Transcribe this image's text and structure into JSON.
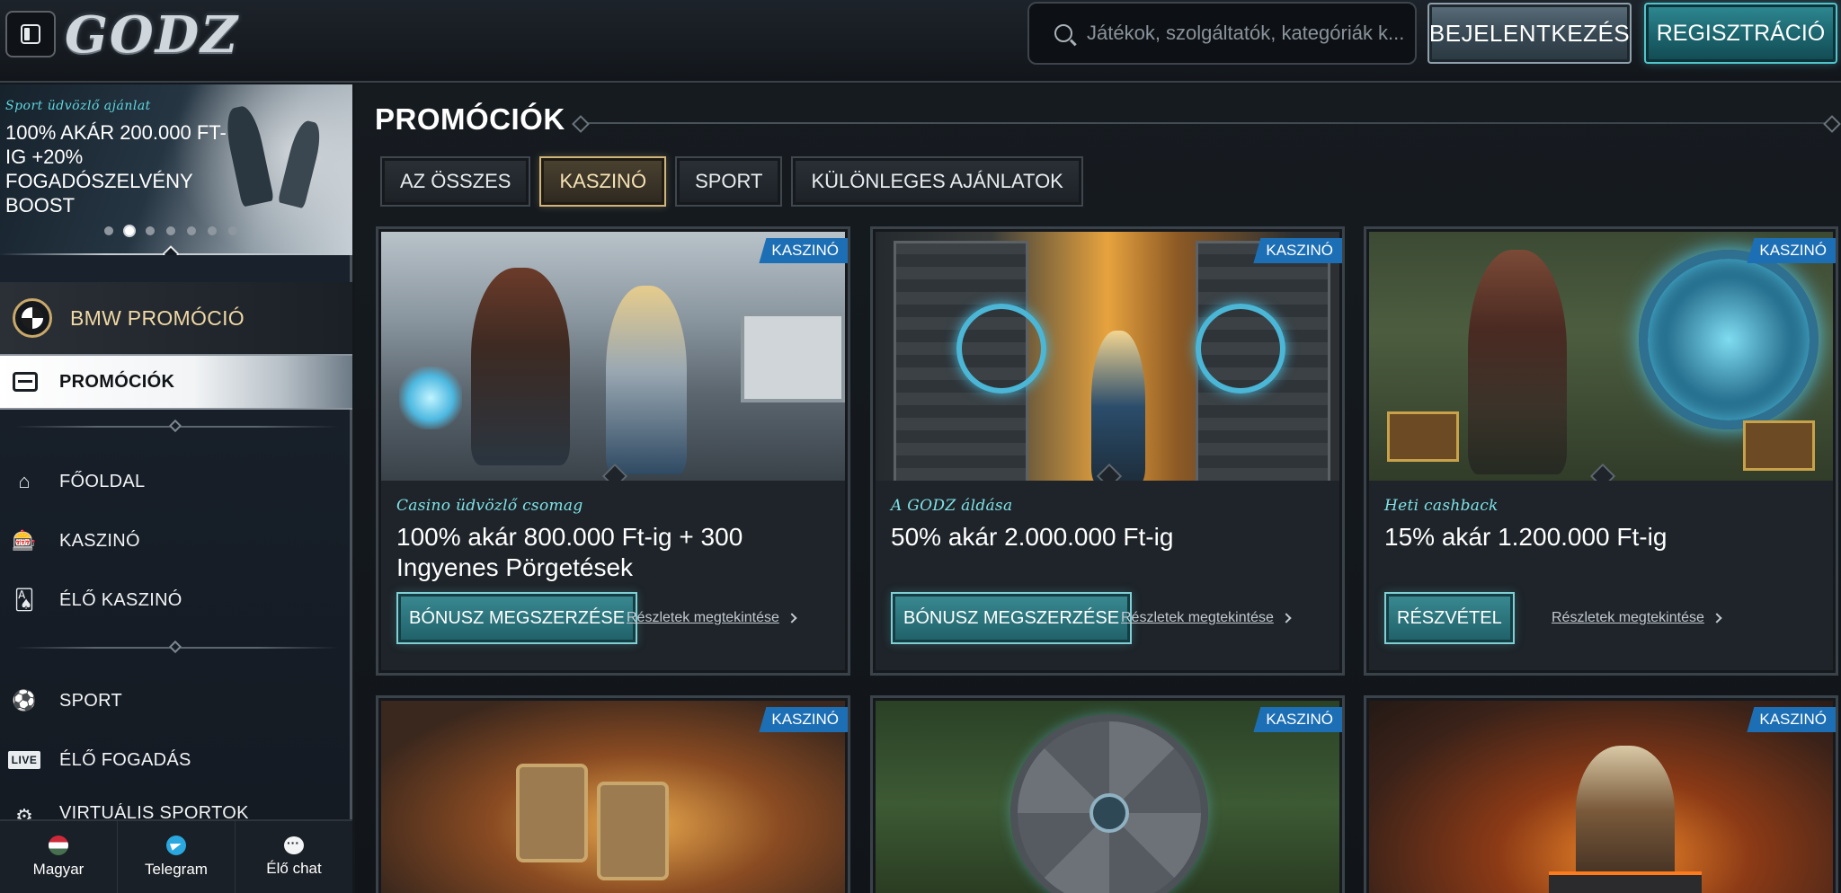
{
  "header": {
    "logo_text": "GODZ",
    "search_placeholder": "Játékok, szolgáltatók, kategóriák k...",
    "login_label": "BEJELENTKEZÉS",
    "register_label": "REGISZTRÁCIÓ"
  },
  "sidebar": {
    "banner": {
      "subtitle": "Sport üdvözlő ajánlat",
      "title": "100% AKÁR 200.000 FT-IG +20% FOGADÓSZELVÉNY BOOST",
      "dots_total": 7,
      "active_dot": 2
    },
    "bmw_label": "BMW PROMÓCIÓ",
    "promo_label": "PROMÓCIÓK",
    "nav": [
      {
        "label": "FŐOLDAL",
        "icon": "home-icon"
      },
      {
        "label": "KASZINÓ",
        "icon": "slot-machine-icon"
      },
      {
        "label": "ÉLŐ KASZINÓ",
        "icon": "cards-icon"
      },
      {
        "label": "SPORT",
        "icon": "soccer-ball-icon"
      },
      {
        "label": "ÉLŐ FOGADÁS",
        "icon": "live-icon",
        "icon_text": "LIVE"
      },
      {
        "label": "VIRTUÁLIS SPORTOK",
        "icon": "virtual-sports-icon"
      }
    ],
    "footer": [
      {
        "label": "Magyar",
        "icon": "hungary-flag-icon"
      },
      {
        "label": "Telegram",
        "icon": "telegram-icon"
      },
      {
        "label": "Élő chat",
        "icon": "chat-icon"
      }
    ]
  },
  "main": {
    "title": "PROMÓCIÓK",
    "tabs": [
      {
        "label": "AZ ÖSSZES",
        "active": false
      },
      {
        "label": "KASZINÓ",
        "active": true
      },
      {
        "label": "SPORT",
        "active": false
      },
      {
        "label": "KÜLÖNLEGES AJÁNLATOK",
        "active": false
      }
    ],
    "cards": [
      {
        "badge": "KASZINÓ",
        "subtitle": "Casino üdvözlő csomag",
        "title": "100% akár 800.000 Ft-ig + 300 Ingyenes Pörgetések",
        "button": "BÓNUSZ MEGSZERZÉSE",
        "link": "Részletek megtekintése"
      },
      {
        "badge": "KASZINÓ",
        "subtitle": "A GODZ áldása",
        "title": "50% akár 2.000.000 Ft-ig",
        "button": "BÓNUSZ MEGSZERZÉSE",
        "link": "Részletek megtekintése"
      },
      {
        "badge": "KASZINÓ",
        "subtitle": "Heti cashback",
        "title": "15% akár 1.200.000 Ft-ig",
        "button": "RÉSZVÉTEL",
        "link": "Részletek megtekintése"
      },
      {
        "badge": "KASZINÓ"
      },
      {
        "badge": "KASZINÓ"
      },
      {
        "badge": "KASZINÓ"
      }
    ]
  },
  "colors": {
    "accent_teal": "#1f6068",
    "accent_gold": "#cfb57a",
    "badge_blue": "#1d6fb5",
    "background": "#14181d"
  }
}
